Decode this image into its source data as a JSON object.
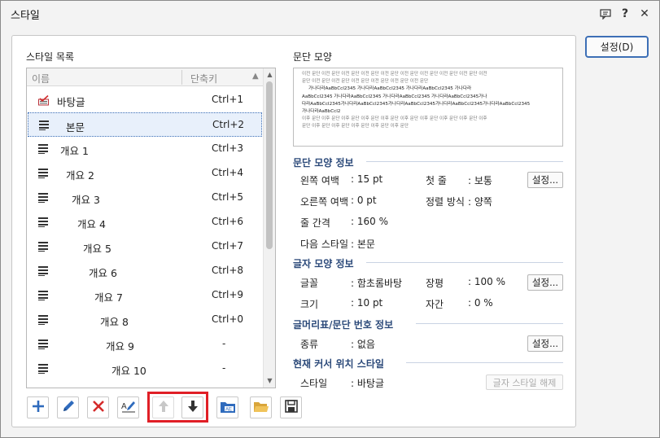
{
  "window": {
    "title": "스타일",
    "help_label": "?",
    "close_label": "✕"
  },
  "side": {
    "settings_label": "설정(D)"
  },
  "list": {
    "label": "스타일 목록",
    "col_name": "이름",
    "col_key": "단축키",
    "items": [
      {
        "name": "바탕글",
        "key": "Ctrl+1"
      },
      {
        "name": "본문",
        "key": "Ctrl+2"
      },
      {
        "name": "개요 1",
        "key": "Ctrl+3"
      },
      {
        "name": "개요 2",
        "key": "Ctrl+4"
      },
      {
        "name": "개요 3",
        "key": "Ctrl+5"
      },
      {
        "name": "개요 4",
        "key": "Ctrl+6"
      },
      {
        "name": "개요 5",
        "key": "Ctrl+7"
      },
      {
        "name": "개요 6",
        "key": "Ctrl+8"
      },
      {
        "name": "개요 7",
        "key": "Ctrl+9"
      },
      {
        "name": "개요 8",
        "key": "Ctrl+0"
      },
      {
        "name": "개요 9",
        "key": "-"
      },
      {
        "name": "개요 10",
        "key": "-"
      }
    ],
    "selected_item": "본문"
  },
  "preview": {
    "label": "문단 모양",
    "lines": [
      "이전 문단 이전 문단 이전 문단 이전 문단 이전 문단 이전 문단 이전 문단 이전 문단 이전 문단 이전",
      "문단 이전 문단 이전 문단 이전 문단 이전 문단 이전 문단 이전 문단",
      "가나다라AaBbCcI2345   가나다라AaBbCcI2345   가나다라AaBbCcI2345   가나다라",
      "AaBbCcI2345   가나다라AaBbCcI2345   가나다라AaBbCcI2345   가나다라AaBbCcI2345가나",
      "다라AaBbCcI2345가나다라AaBbCcI2345가나다라AaBbCcI2345가나다라AaBbCcI2345가나다라AaBbCcI2345",
      "가나다라AaBbCcI2",
      "이후 문단 이후 문단 이후 문단 이후 문단 이후 문단 이후 문단 이후 문단 이후 문단 이후 문단 이후",
      "문단 이후 문단 이후 문단 이후 문단 이후 문단 이후 문단"
    ]
  },
  "para_info": {
    "title": "문단 모양 정보",
    "left_margin_label": "왼쪽 여백",
    "left_margin_value": ": 15 pt",
    "first_line_label": "첫 줄",
    "first_line_value": ": 보통",
    "right_margin_label": "오른쪽 여백",
    "right_margin_value": ": 0 pt",
    "align_label": "정렬 방식",
    "align_value": ": 양쪽",
    "line_spacing_label": "줄 간격",
    "line_spacing_value": ": 160 %",
    "next_style_label": "다음 스타일",
    "next_style_value": ": 본문",
    "settings_label": "설정..."
  },
  "char_info": {
    "title": "글자 모양 정보",
    "font_label": "글꼴",
    "font_value": ": 함초롬바탕",
    "ratio_label": "장평",
    "ratio_value": ": 100 %",
    "size_label": "크기",
    "size_value": ": 10 pt",
    "spacing_label": "자간",
    "spacing_value": ": 0 %",
    "settings_label": "설정..."
  },
  "bullet_info": {
    "title": "글머리표/문단 번호 정보",
    "kind_label": "종류",
    "kind_value": ": 없음",
    "settings_label": "설정..."
  },
  "cursor_info": {
    "title": "현재 커서 위치 스타일",
    "style_label": "스타일",
    "style_value": ": 바탕글",
    "clear_label": "글자 스타일 해제"
  },
  "colors": {
    "accent": "#3d6fb6",
    "highlight": "#e01f26",
    "section_title": "#2c4a7a"
  }
}
